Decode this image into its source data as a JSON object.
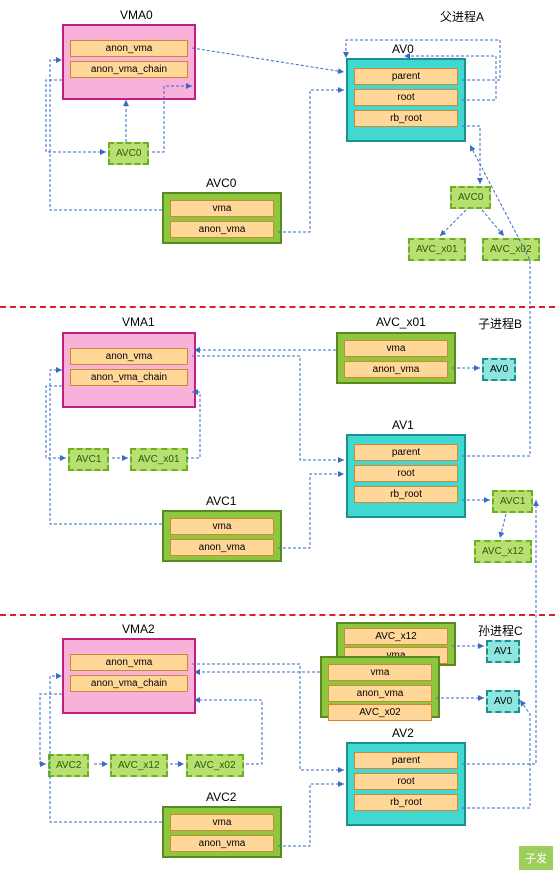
{
  "sections": {
    "a": {
      "title": "父进程A"
    },
    "b": {
      "title": "子进程B"
    },
    "c": {
      "title": "孙进程C"
    }
  },
  "vma0": {
    "title": "VMA0",
    "f1": "anon_vma",
    "f2": "anon_vma_chain"
  },
  "av0": {
    "title": "AV0",
    "f1": "parent",
    "f2": "root",
    "f3": "rb_root"
  },
  "avc0_small": "AVC0",
  "avc0_box": {
    "title": "AVC0",
    "f1": "vma",
    "f2": "anon_vma"
  },
  "tree_a": {
    "root": "AVC0",
    "left": "AVC_x01",
    "right": "AVC_x02"
  },
  "vma1": {
    "title": "VMA1",
    "f1": "anon_vma",
    "f2": "anon_vma_chain"
  },
  "avc_x01": {
    "title": "AVC_x01",
    "f1": "vma",
    "f2": "anon_vma"
  },
  "av0_ref_b": "AV0",
  "av1": {
    "title": "AV1",
    "f1": "parent",
    "f2": "root",
    "f3": "rb_root"
  },
  "avc1_small": "AVC1",
  "avc_x01_small": "AVC_x01",
  "avc1_box": {
    "title": "AVC1",
    "f1": "vma",
    "f2": "anon_vma"
  },
  "tree_b": {
    "root": "AVC1",
    "child": "AVC_x12"
  },
  "vma2": {
    "title": "VMA2",
    "f1": "anon_vma",
    "f2": "anon_vma_chain"
  },
  "avc_x12": {
    "title": "AVC_x12",
    "f1": "vma"
  },
  "avc_x02": {
    "f1": "vma",
    "f2": "anon_vma",
    "f3": "AVC_x02"
  },
  "av1_ref_c": "AV1",
  "av0_ref_c": "AV0",
  "av2": {
    "title": "AV2",
    "f1": "parent",
    "f2": "root",
    "f3": "rb_root"
  },
  "avc2_small": "AVC2",
  "avc_x12_small": "AVC_x12",
  "avc_x02_small": "AVC_x02",
  "avc2_box": {
    "title": "AVC2",
    "f1": "vma",
    "f2": "anon_vma"
  },
  "watermark": "子发"
}
